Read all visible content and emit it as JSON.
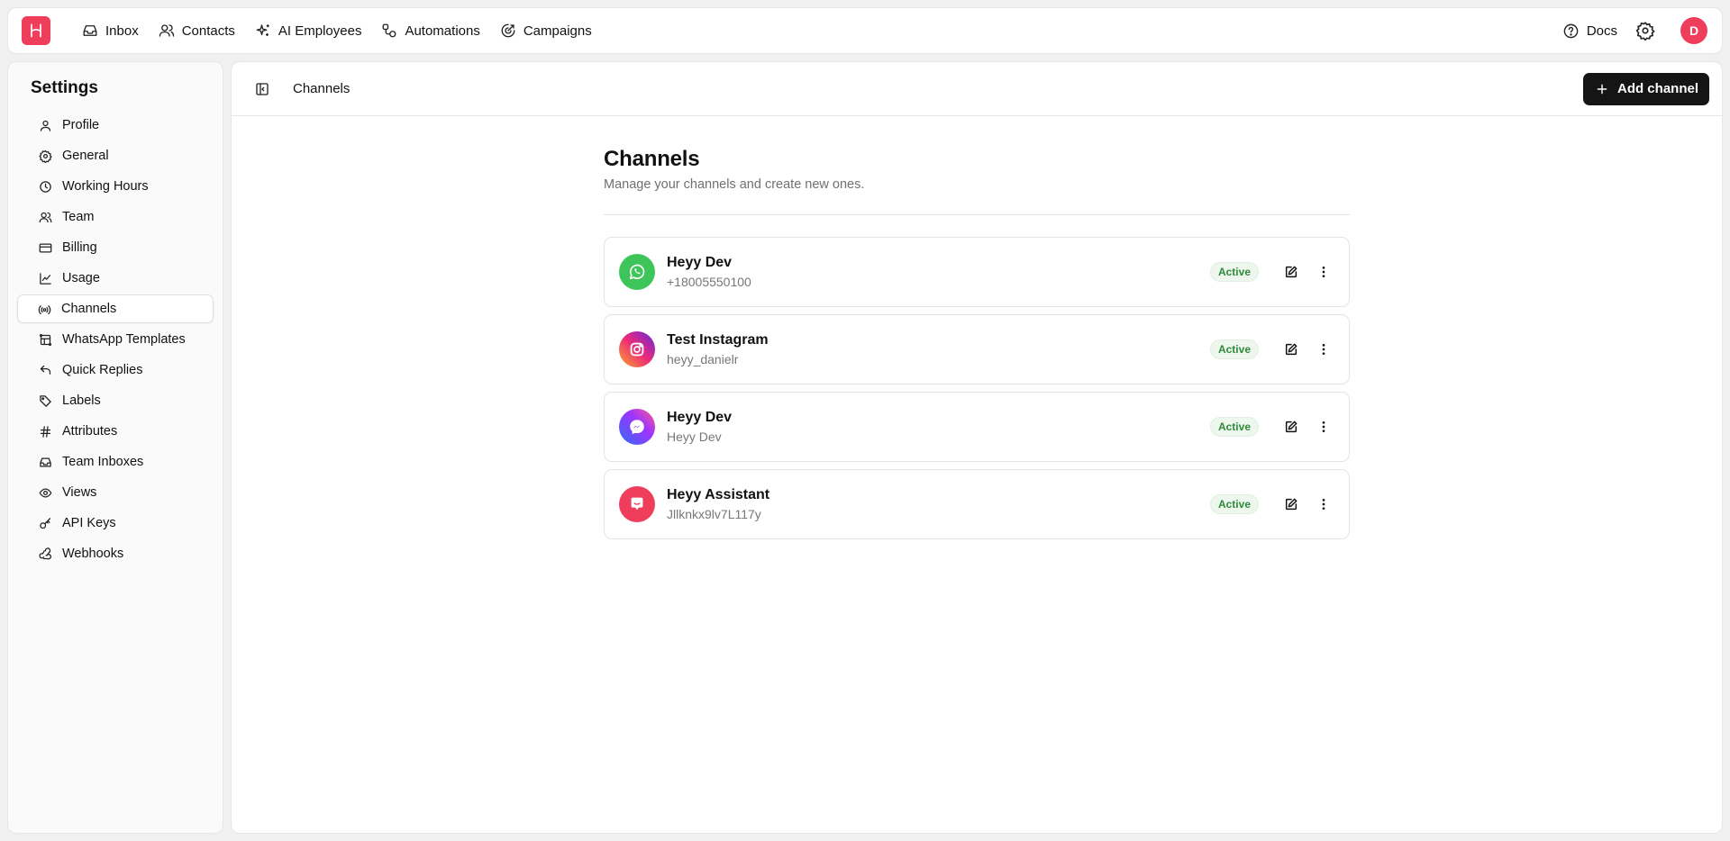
{
  "topnav": {
    "logo_icon": "heyy-logo-icon",
    "items": [
      {
        "label": "Inbox",
        "icon": "inbox-icon"
      },
      {
        "label": "Contacts",
        "icon": "contacts-icon"
      },
      {
        "label": "AI Employees",
        "icon": "sparkles-icon"
      },
      {
        "label": "Automations",
        "icon": "automation-icon"
      },
      {
        "label": "Campaigns",
        "icon": "campaign-icon"
      }
    ],
    "docs_label": "Docs",
    "avatar_initial": "D",
    "brand_color": "#ef3e5c"
  },
  "sidebar": {
    "title": "Settings",
    "active_item": "Channels",
    "items": [
      {
        "label": "Profile",
        "icon": "user-icon"
      },
      {
        "label": "General",
        "icon": "gear-icon"
      },
      {
        "label": "Working Hours",
        "icon": "clock-icon"
      },
      {
        "label": "Team",
        "icon": "team-icon"
      },
      {
        "label": "Billing",
        "icon": "credit-card-icon"
      },
      {
        "label": "Usage",
        "icon": "chart-icon"
      },
      {
        "label": "Channels",
        "icon": "broadcast-icon"
      },
      {
        "label": "WhatsApp Templates",
        "icon": "template-icon"
      },
      {
        "label": "Quick Replies",
        "icon": "reply-icon"
      },
      {
        "label": "Labels",
        "icon": "tag-icon"
      },
      {
        "label": "Attributes",
        "icon": "hash-icon"
      },
      {
        "label": "Team Inboxes",
        "icon": "inbox-icon"
      },
      {
        "label": "Views",
        "icon": "eye-icon"
      },
      {
        "label": "API Keys",
        "icon": "key-icon"
      },
      {
        "label": "Webhooks",
        "icon": "webhook-icon"
      }
    ]
  },
  "header": {
    "breadcrumb": "Channels",
    "add_button_label": "Add channel"
  },
  "main": {
    "title": "Channels",
    "subtitle": "Manage your channels and create new ones.",
    "channels": [
      {
        "name": "Heyy Dev",
        "sub": "+18005550100",
        "status": "Active",
        "type": "whatsapp",
        "color": "#3ec55a"
      },
      {
        "name": "Test Instagram",
        "sub": "heyy_danielr",
        "status": "Active",
        "type": "instagram",
        "color": "#d62976"
      },
      {
        "name": "Heyy Dev",
        "sub": "Heyy Dev",
        "status": "Active",
        "type": "messenger",
        "color": "#7b3ff2"
      },
      {
        "name": "Heyy Assistant",
        "sub": "Jllknkx9lv7L117y",
        "status": "Active",
        "type": "assistant",
        "color": "#ef3e5c"
      }
    ]
  }
}
